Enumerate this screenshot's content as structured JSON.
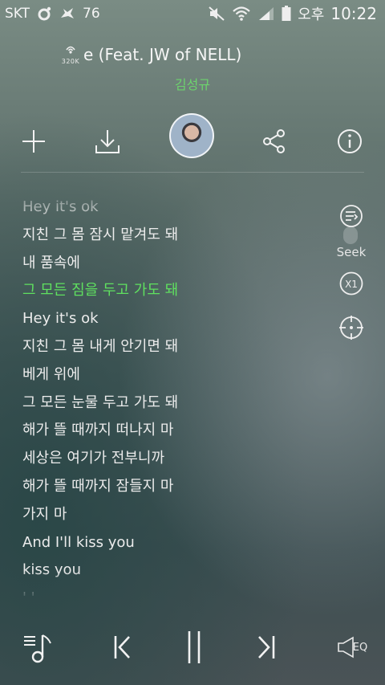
{
  "status_bar": {
    "carrier": "SKT",
    "notification_count": "76",
    "ampm": "오후",
    "time": "10:22",
    "icons": [
      "carrier-o-icon",
      "bird-icon",
      "mute-icon",
      "wifi-icon",
      "signal-icon",
      "battery-icon"
    ]
  },
  "song": {
    "bitrate": "320K",
    "title": "e (Feat. JW of NELL)",
    "artist": "김성규"
  },
  "actions": {
    "icons": [
      "plus-icon",
      "download-icon",
      "album-art",
      "share-icon",
      "info-icon"
    ]
  },
  "lyrics": {
    "lines": [
      "Hey it's ok",
      "지친 그 몸 잠시 맡겨도 돼",
      "내 품속에",
      "그 모든 짐을 두고 가도 돼",
      "Hey it's ok",
      "지친 그 몸 내게 안기면 돼",
      "베게 위에",
      "그 모든 눈물 두고 가도 돼",
      "해가 뜰 때까지 떠나지 마",
      "세상은 여기가 전부니까",
      "해가 뜰 때까지 잠들지 마",
      "가지 마",
      "And I'll kiss you",
      "kiss you",
      "' '"
    ],
    "current_index": 3
  },
  "side_controls": {
    "seek_label": "Seek",
    "speed_label": "X1"
  },
  "player": {
    "eq_label": "EQ"
  },
  "colors": {
    "accent": "#5fe05f",
    "artist": "#6dd36d"
  }
}
